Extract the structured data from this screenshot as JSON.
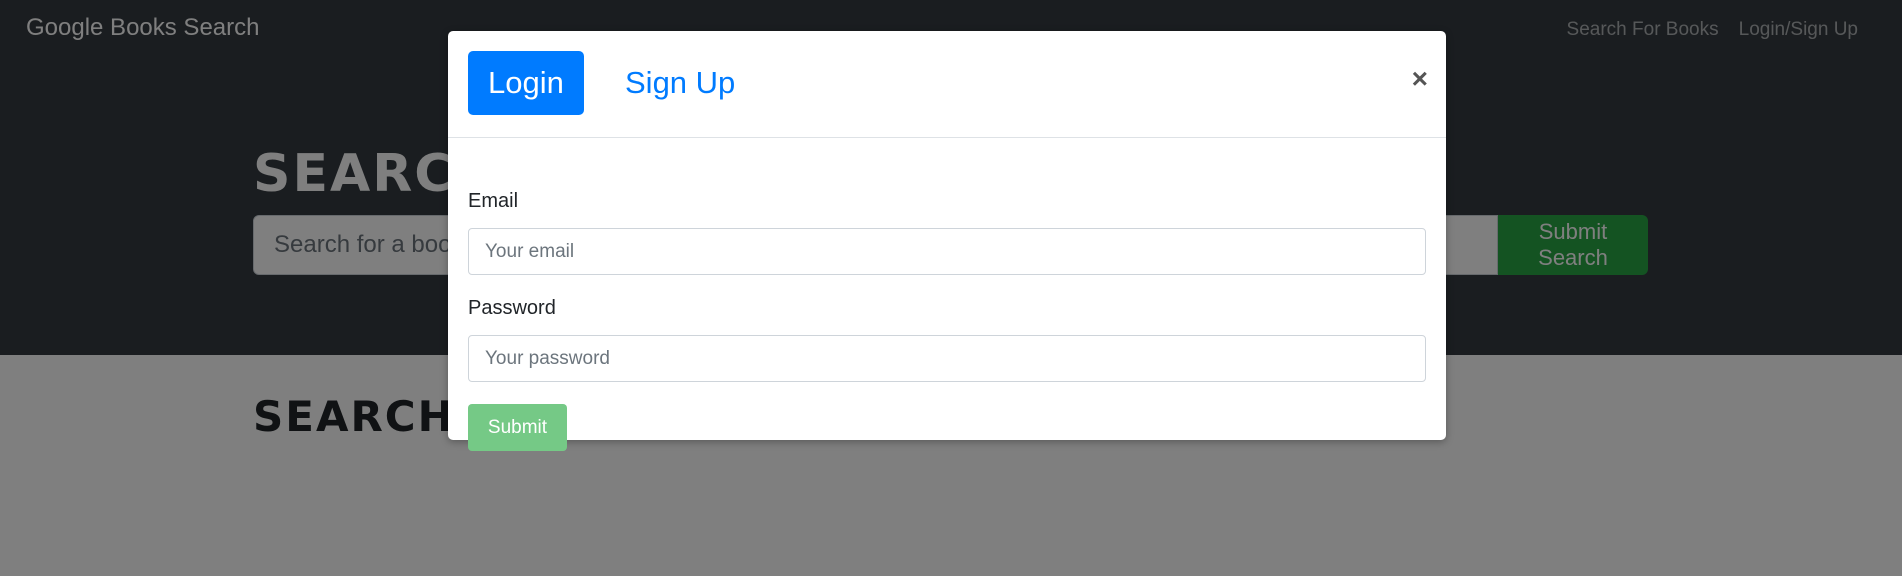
{
  "navbar": {
    "brand": "Google Books Search",
    "links": [
      "Search For Books",
      "Login/Sign Up"
    ]
  },
  "hero": {
    "title": "SEARCH FOR BOOKS!",
    "search_placeholder": "Search for a book",
    "search_button": "Submit Search"
  },
  "results": {
    "title": "SEARCH FOR A BOOK TO BEGIN"
  },
  "modal": {
    "tabs": [
      "Login",
      "Sign Up"
    ],
    "active_tab": "Login",
    "close_symbol": "×",
    "email_label": "Email",
    "email_placeholder": "Your email",
    "password_label": "Password",
    "password_placeholder": "Your password",
    "submit_label": "Submit"
  },
  "colors": {
    "navbar_bg": "#343a40",
    "primary": "#007bff",
    "success_disabled": "#75c986"
  }
}
